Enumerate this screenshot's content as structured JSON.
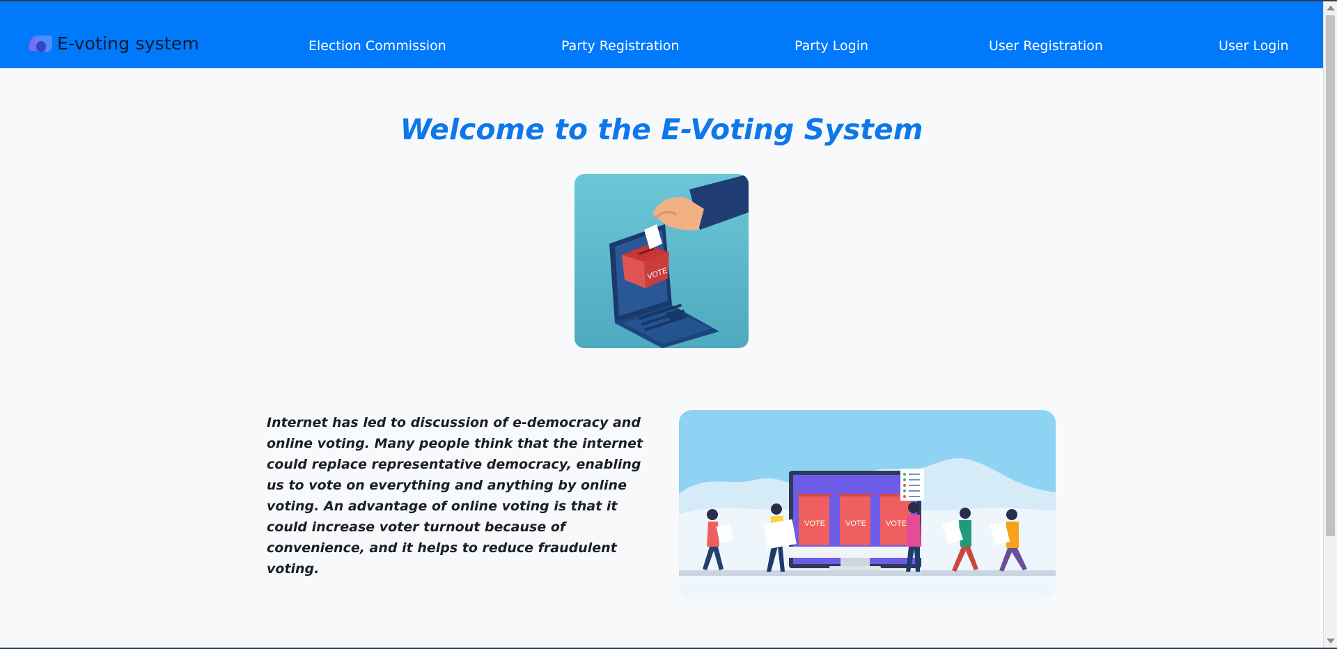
{
  "brand": {
    "name": "E-voting system",
    "logo_icon": "drop-leaf-logo-icon"
  },
  "nav": {
    "links": [
      {
        "label": "Election Commission"
      },
      {
        "label": "Party Registration"
      },
      {
        "label": "Party Login"
      },
      {
        "label": "User Registration"
      },
      {
        "label": "User Login"
      }
    ]
  },
  "main": {
    "title": "Welcome to the E-Voting System",
    "hero_image": "hand-casting-ballot-into-laptop-illustration",
    "hero_box_label": "VOTE",
    "intro": "Internet has led to discussion of e-democracy and online voting. Many people think that the internet could replace representative democracy, enabling us to vote on everything and anything by online voting. An advantage of online voting is that it could increase voter turnout because of convenience, and it helps to reduce fraudulent voting.",
    "vote_image": "people-voting-at-monitor-ballot-boxes-illustration",
    "ballot_labels": [
      "VOTE",
      "VOTE",
      "VOTE"
    ]
  },
  "colors": {
    "navbar": "#0079fb",
    "title": "#0d78ea",
    "page_bg": "#f8f9fb",
    "ballot_box": "#ea5c5c"
  }
}
